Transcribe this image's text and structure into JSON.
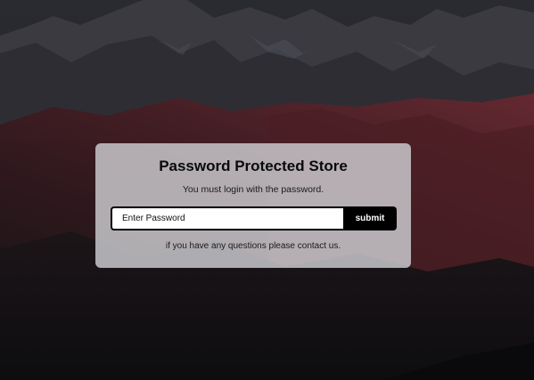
{
  "page": {
    "title": "Password Protected Store",
    "subtitle": "You must login with the password.",
    "password_placeholder": "Enter Password",
    "submit_label": "submit",
    "contact_text": "if you have any questions please contact us."
  },
  "colors": {
    "overlay_card": "#cecdd2",
    "button_bg": "#000000",
    "button_text": "#ffffff",
    "background_dark": "#15161a",
    "mountain_red": "#5a2128"
  }
}
